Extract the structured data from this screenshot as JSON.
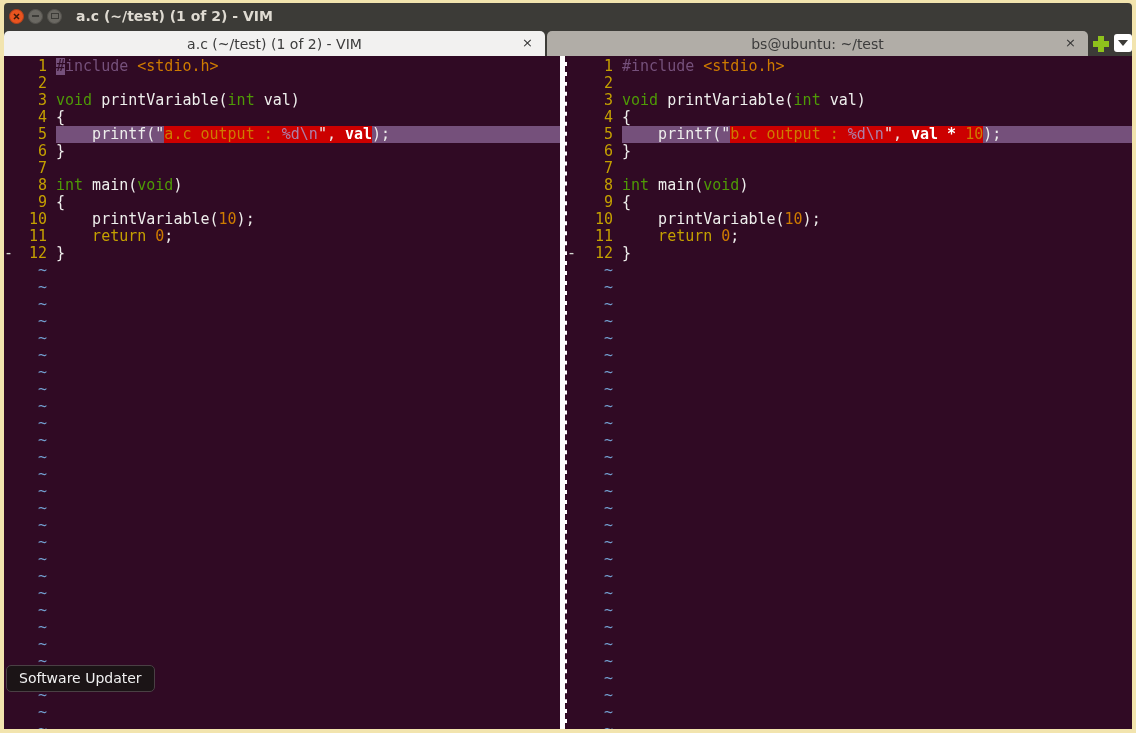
{
  "window": {
    "title": "a.c (~/test) (1 of 2) - VIM"
  },
  "tabs": [
    {
      "label": "a.c (~/test) (1 of 2) - VIM",
      "selected": true,
      "close": "×"
    },
    {
      "label": "bs@ubuntu: ~/test",
      "selected": false,
      "close": "×"
    }
  ],
  "panes": [
    {
      "fold_mark": "-",
      "lines": [
        {
          "number": "1",
          "changed": false,
          "tokens": [
            {
              "text": "#",
              "kind": "preproc",
              "cursor": true
            },
            {
              "text": "include",
              "kind": "preproc",
              "cursor": false
            },
            {
              "text": " <stdio.h>",
              "kind": "string"
            }
          ]
        },
        {
          "number": "2",
          "changed": false
        },
        {
          "number": "3",
          "changed": false,
          "tokens": [
            {
              "text": "void",
              "kind": "type"
            },
            {
              "text": " printVariable(",
              "kind": "plain"
            },
            {
              "text": "int",
              "kind": "type"
            },
            {
              "text": " val)",
              "kind": "plain"
            }
          ]
        },
        {
          "number": "4",
          "changed": false,
          "tokens": [
            {
              "text": "{",
              "kind": "plain"
            }
          ]
        },
        {
          "number": "5",
          "changed": true,
          "indent": true,
          "tokens": [
            {
              "text": "printf(\"",
              "kind": "plain",
              "diff": false
            },
            {
              "text": "a.c output : ",
              "kind": "string",
              "diff": true
            },
            {
              "text": "%d\\n",
              "kind": "special",
              "diff": true
            },
            {
              "text": "\", ",
              "kind": "plain",
              "diff": true
            },
            {
              "text": "val",
              "kind": "bold",
              "diff": true
            },
            {
              "text": ");",
              "kind": "plain",
              "diff": false
            }
          ]
        },
        {
          "number": "6",
          "changed": false,
          "tokens": [
            {
              "text": "}",
              "kind": "plain"
            }
          ]
        },
        {
          "number": "7",
          "changed": false
        },
        {
          "number": "8",
          "changed": false,
          "tokens": [
            {
              "text": "int",
              "kind": "type"
            },
            {
              "text": " main(",
              "kind": "plain"
            },
            {
              "text": "void",
              "kind": "type"
            },
            {
              "text": ")",
              "kind": "plain"
            }
          ]
        },
        {
          "number": "9",
          "changed": false,
          "tokens": [
            {
              "text": "{",
              "kind": "plain"
            }
          ]
        },
        {
          "number": "10",
          "changed": false,
          "indent": true,
          "tokens": [
            {
              "text": "printVariable(",
              "kind": "plain"
            },
            {
              "text": "10",
              "kind": "number"
            },
            {
              "text": ");",
              "kind": "plain"
            }
          ]
        },
        {
          "number": "11",
          "changed": false,
          "indent": true,
          "tokens": [
            {
              "text": "return ",
              "kind": "statement"
            },
            {
              "text": "0",
              "kind": "number"
            },
            {
              "text": ";",
              "kind": "plain"
            }
          ]
        },
        {
          "number": "12",
          "changed": false,
          "tokens": [
            {
              "text": "}",
              "kind": "plain"
            }
          ]
        }
      ],
      "fillers": [
        "~",
        "~",
        "~",
        "~",
        "~",
        "~",
        "~",
        "~",
        "~",
        "~",
        "~",
        "~",
        "~",
        "~",
        "~",
        "~",
        "~",
        "~",
        "~",
        "~",
        "~",
        "~",
        "~",
        "~"
      ],
      "fillers_after": [
        "~",
        "~",
        "~"
      ]
    },
    {
      "fold_mark": "-",
      "lines": [
        {
          "number": "1",
          "changed": false,
          "tokens": [
            {
              "text": "#include",
              "kind": "preproc"
            },
            {
              "text": " <stdio.h>",
              "kind": "string"
            }
          ]
        },
        {
          "number": "2",
          "changed": false
        },
        {
          "number": "3",
          "changed": false,
          "tokens": [
            {
              "text": "void",
              "kind": "type"
            },
            {
              "text": " printVariable(",
              "kind": "plain"
            },
            {
              "text": "int",
              "kind": "type"
            },
            {
              "text": " val)",
              "kind": "plain"
            }
          ]
        },
        {
          "number": "4",
          "changed": false,
          "tokens": [
            {
              "text": "{",
              "kind": "plain"
            }
          ]
        },
        {
          "number": "5",
          "changed": true,
          "indent": true,
          "tokens": [
            {
              "text": "printf(\"",
              "kind": "plain",
              "diff": false
            },
            {
              "text": "b.c output : ",
              "kind": "string",
              "diff": true
            },
            {
              "text": "%d\\n",
              "kind": "special",
              "diff": true
            },
            {
              "text": "\", ",
              "kind": "plain",
              "diff": true
            },
            {
              "text": "val * ",
              "kind": "bold",
              "diff": true
            },
            {
              "text": "10",
              "kind": "number",
              "diff": true
            },
            {
              "text": ");",
              "kind": "plain",
              "diff": false
            }
          ]
        },
        {
          "number": "6",
          "changed": false,
          "tokens": [
            {
              "text": "}",
              "kind": "plain"
            }
          ]
        },
        {
          "number": "7",
          "changed": false
        },
        {
          "number": "8",
          "changed": false,
          "tokens": [
            {
              "text": "int",
              "kind": "type"
            },
            {
              "text": " main(",
              "kind": "plain"
            },
            {
              "text": "void",
              "kind": "type"
            },
            {
              "text": ")",
              "kind": "plain"
            }
          ]
        },
        {
          "number": "9",
          "changed": false,
          "tokens": [
            {
              "text": "{",
              "kind": "plain"
            }
          ]
        },
        {
          "number": "10",
          "changed": false,
          "indent": true,
          "tokens": [
            {
              "text": "printVariable(",
              "kind": "plain"
            },
            {
              "text": "10",
              "kind": "number"
            },
            {
              "text": ");",
              "kind": "plain"
            }
          ]
        },
        {
          "number": "11",
          "changed": false,
          "indent": true,
          "tokens": [
            {
              "text": "return ",
              "kind": "statement"
            },
            {
              "text": "0",
              "kind": "number"
            },
            {
              "text": ";",
              "kind": "plain"
            }
          ]
        },
        {
          "number": "12",
          "changed": false,
          "tokens": [
            {
              "text": "}",
              "kind": "plain"
            }
          ]
        }
      ],
      "fillers": [
        "~",
        "~",
        "~",
        "~",
        "~",
        "~",
        "~",
        "~",
        "~",
        "~",
        "~",
        "~",
        "~",
        "~",
        "~",
        "~",
        "~",
        "~",
        "~",
        "~",
        "~",
        "~",
        "~",
        "~",
        "~",
        "~",
        "~",
        "~"
      ]
    }
  ],
  "tooltip": {
    "text": "Software Updater"
  }
}
